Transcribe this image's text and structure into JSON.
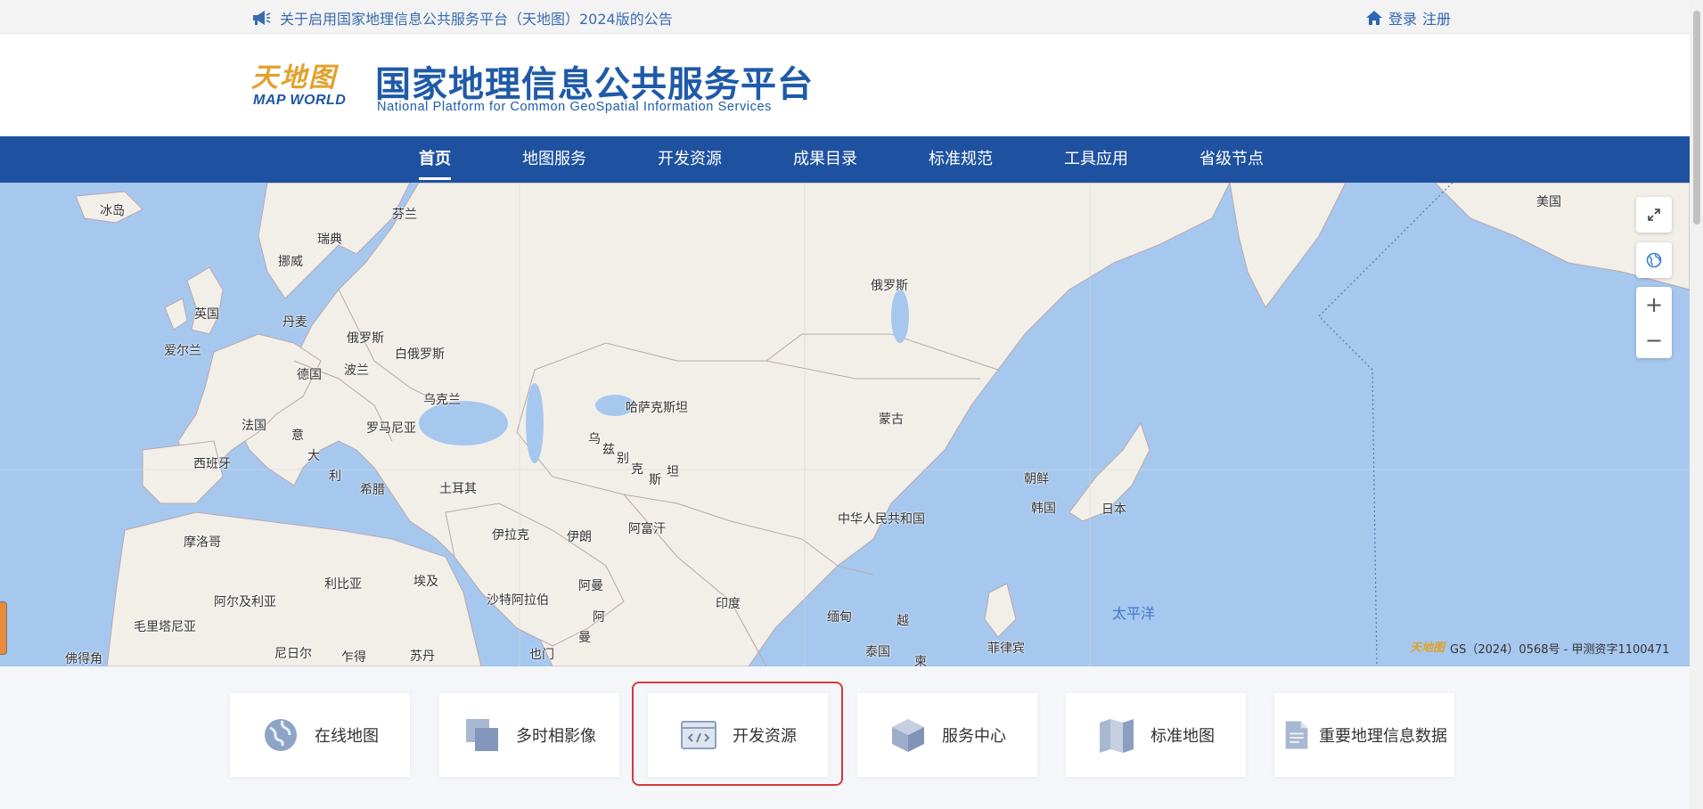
{
  "notice": {
    "text": "关于启用国家地理信息公共服务平台（天地图）2024版的公告",
    "icon": "megaphone-icon"
  },
  "auth": {
    "login": "登录",
    "register": "注册",
    "icon": "home-icon"
  },
  "header": {
    "logo_cn": "天地图",
    "logo_en": "MAP WORLD",
    "title": "国家地理信息公共服务平台",
    "subtitle": "National Platform for Common GeoSpatial Information Services"
  },
  "nav": {
    "items": [
      {
        "label": "首页",
        "active": true
      },
      {
        "label": "地图服务"
      },
      {
        "label": "开发资源"
      },
      {
        "label": "成果目录"
      },
      {
        "label": "标准规范"
      },
      {
        "label": "工具应用"
      },
      {
        "label": "省级节点"
      }
    ]
  },
  "map": {
    "labels": {
      "iceland": "冰岛",
      "finland": "芬兰",
      "sweden": "瑞典",
      "norway": "挪威",
      "uk": "英国",
      "denmark": "丹麦",
      "ireland": "爱尔兰",
      "russia_w": "俄罗斯",
      "belarus": "白俄罗斯",
      "germany": "德国",
      "poland": "波兰",
      "ukraine": "乌克兰",
      "france": "法国",
      "italy_1": "意",
      "italy_2": "大",
      "italy_3": "利",
      "romania": "罗马尼亚",
      "spain": "西班牙",
      "greece": "希腊",
      "turkey": "土耳其",
      "morocco": "摩洛哥",
      "algeria": "阿尔及利亚",
      "libya": "利比亚",
      "egypt": "埃及",
      "mauritania": "毛里塔尼亚",
      "cape_verde": "佛得角",
      "niger": "尼日尔",
      "chad": "乍得",
      "sudan": "苏丹",
      "iraq": "伊拉克",
      "iran": "伊朗",
      "saudi": "沙特阿拉伯",
      "oman": "阿曼",
      "yemen": "也门",
      "oman_2": "阿",
      "oman_3": "曼",
      "kazakhstan": "哈萨克斯坦",
      "uz_1": "乌",
      "uz_2": "兹",
      "uz_3": "别",
      "uz_4": "克",
      "uz_5": "斯",
      "uz_6": "坦",
      "afghanistan": "阿富汗",
      "india": "印度",
      "russia": "俄罗斯",
      "mongolia": "蒙古",
      "china": "中华人民共和国",
      "north_korea": "朝鲜",
      "south_korea": "韩国",
      "japan": "日本",
      "myanmar": "缅甸",
      "vietnam": "越",
      "thailand": "泰国",
      "cambodia": "柬",
      "philippines": "菲律宾",
      "pacific": "太平洋",
      "usa": "美国"
    },
    "copyright_logo": "天地图",
    "copyright": "GS（2024）0568号 - 甲测资字1100471",
    "controls": {
      "fullscreen_icon": "fullscreen-icon",
      "globe_icon": "globe-icon",
      "zoom_in": "+",
      "zoom_out": "−"
    }
  },
  "cards": [
    {
      "label": "在线地图",
      "icon": "globe-icon"
    },
    {
      "label": "多时相影像",
      "icon": "layers-icon"
    },
    {
      "label": "开发资源",
      "icon": "code-window-icon",
      "highlighted": true
    },
    {
      "label": "服务中心",
      "icon": "cube-icon"
    },
    {
      "label": "标准地图",
      "icon": "folded-map-icon"
    },
    {
      "label": "重要地理信息数据",
      "icon": "document-icon"
    }
  ],
  "colors": {
    "brand_blue": "#1e51a0",
    "logo_gold": "#e1a12c",
    "map_water": "#a6c8ef",
    "map_land": "#f2efe9",
    "highlight_red": "#d23b3b"
  }
}
